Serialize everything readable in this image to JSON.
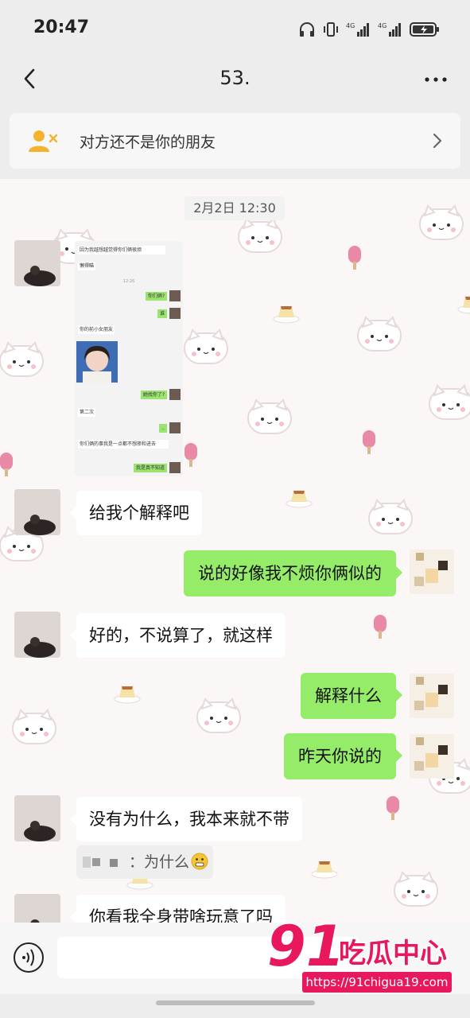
{
  "status_bar": {
    "time": "20:47",
    "signal_1": "4G",
    "signal_2": "4G"
  },
  "header": {
    "back_icon": "chevron-left-icon",
    "title": "53.",
    "more_icon": "more-dots-icon"
  },
  "banner": {
    "text": "对方还不是你的朋友",
    "icon": "user-x-icon"
  },
  "chat": {
    "timestamp": "2月2日 12:30",
    "screenshot_image": {
      "lines": [
        "因为我越想越觉得你们俩很烦",
        "懒得瞄",
        "12:26",
        "你们俩?",
        "谁",
        "你的前小女朋友",
        "她找你了?",
        "第二次",
        "..",
        "你们俩的事我是一点都不想掺和进去",
        "我是真不知道"
      ]
    },
    "messages": [
      {
        "side": "in",
        "text": "给我个解释吧"
      },
      {
        "side": "out",
        "text": "说的好像我不烦你俩似的"
      },
      {
        "side": "in",
        "text": "好的，不说算了，就这样"
      },
      {
        "side": "out",
        "text": "解释什么"
      },
      {
        "side": "out",
        "text": "昨天你说的"
      },
      {
        "side": "in",
        "text": "没有为什么，我本来就不带"
      },
      {
        "side": "in",
        "text": "你看我全身带啥玩意了吗"
      }
    ],
    "quote": {
      "text": "：为什么"
    }
  },
  "watermark": {
    "logo": "91吃瓜中心",
    "url": "https://91chigua19.com"
  },
  "colors": {
    "outgoing_bubble": "#95ec69",
    "incoming_bubble": "#ffffff",
    "chat_bg": "#fbf7f7",
    "watermark": "#e8185c"
  }
}
